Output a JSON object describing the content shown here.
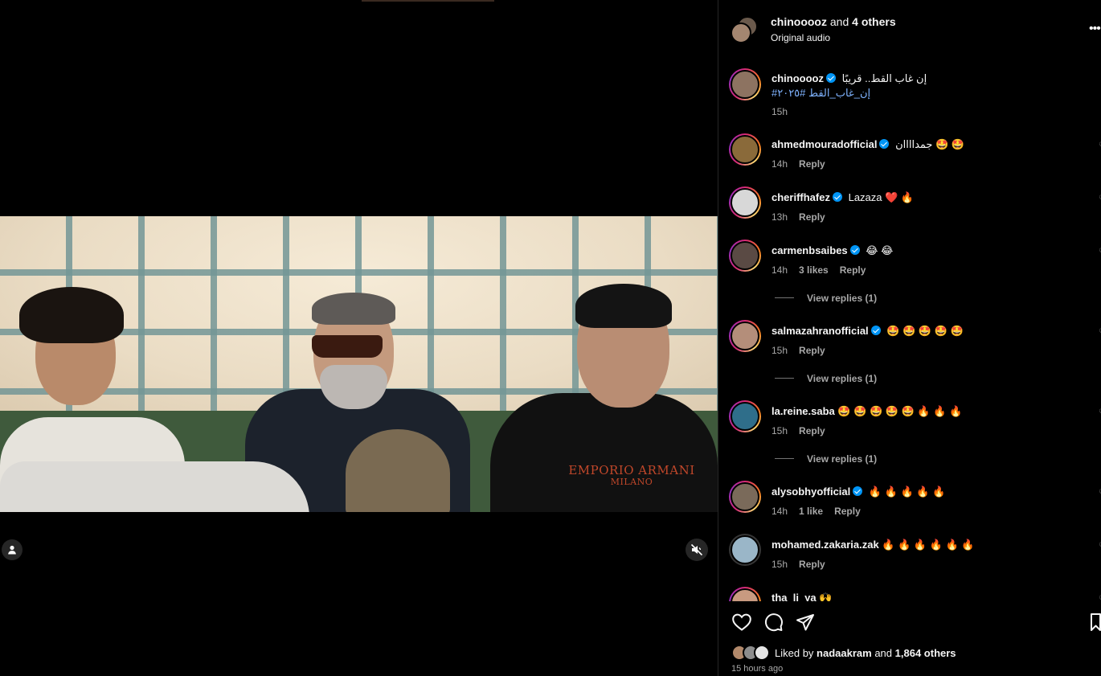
{
  "post": {
    "author": "chinooooz",
    "collab_connector": "and",
    "collab_others": "4 others",
    "audio": "Original audio",
    "caption": "إن غاب القط.. قريبًا",
    "hashtags": "#إن_غاب_القط #٢٠٢٥",
    "caption_time": "15h",
    "shirt_logo_line1": "EMPORIO ARMANI",
    "shirt_logo_line2": "MILANO"
  },
  "comments": [
    {
      "user": "ahmedmouradofficial",
      "verified": true,
      "text": "جمداااان 🤩 🤩",
      "time": "14h",
      "likes": "",
      "reply": "Reply",
      "view_replies": ""
    },
    {
      "user": "cheriffhafez",
      "verified": true,
      "text": "Lazaza ❤️ 🔥",
      "time": "13h",
      "likes": "",
      "reply": "Reply",
      "view_replies": ""
    },
    {
      "user": "carmenbsaibes",
      "verified": true,
      "text": "😂 😂",
      "time": "14h",
      "likes": "3 likes",
      "reply": "Reply",
      "view_replies": "View replies (1)"
    },
    {
      "user": "salmazahranofficial",
      "verified": true,
      "text": "🤩 🤩 🤩 🤩 🤩",
      "time": "15h",
      "likes": "",
      "reply": "Reply",
      "view_replies": "View replies (1)"
    },
    {
      "user": "la.reine.saba",
      "verified": false,
      "text": "🤩 🤩 🤩 🤩 🤩 🔥 🔥 🔥",
      "time": "15h",
      "likes": "",
      "reply": "Reply",
      "view_replies": "View replies (1)"
    },
    {
      "user": "alysobhyofficial",
      "verified": true,
      "text": "🔥 🔥 🔥 🔥 🔥",
      "time": "14h",
      "likes": "1 like",
      "reply": "Reply",
      "view_replies": ""
    },
    {
      "user": "mohamed.zakaria.zak",
      "verified": false,
      "text": "🔥 🔥 🔥 🔥 🔥 🔥",
      "time": "15h",
      "likes": "",
      "reply": "Reply",
      "view_replies": ""
    },
    {
      "user": "tha_li_ya",
      "verified": false,
      "text": "🙌",
      "time": "",
      "likes": "",
      "reply": "",
      "view_replies": ""
    }
  ],
  "footer": {
    "liked_by_prefix": "Liked by",
    "liked_by_user": "nadaakram",
    "liked_by_and": "and",
    "liked_by_others": "1,864 others",
    "time_ago": "15 hours ago"
  },
  "icons": {
    "tag": "user-tag-icon",
    "mute": "muted-speaker-icon",
    "like": "heart-icon",
    "comment": "comment-bubble-icon",
    "share": "paper-plane-icon",
    "save": "bookmark-icon",
    "more": "more-dots-icon"
  },
  "colors": {
    "accent": "#0095f6",
    "hashtag": "#7fb3ff",
    "story_ring": "#d62976",
    "background": "#000000",
    "secondary_text": "#a8a8a8"
  }
}
